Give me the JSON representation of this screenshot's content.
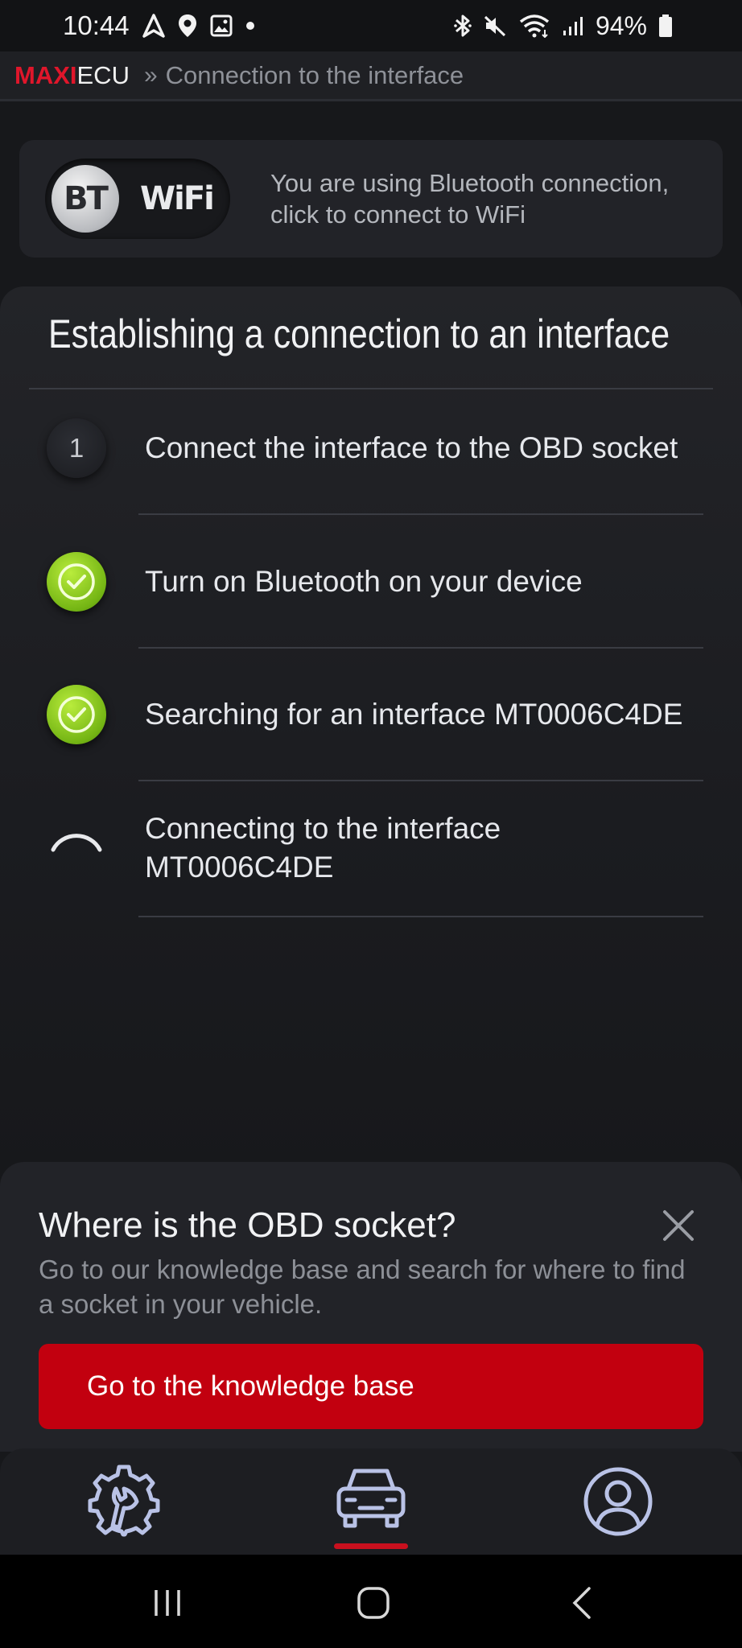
{
  "status_bar": {
    "time": "10:44",
    "battery": "94%",
    "left_icons": [
      "navigation-icon",
      "location-pin-icon",
      "image-icon",
      "dot-icon"
    ],
    "right_icons": [
      "bluetooth-icon",
      "mute-icon",
      "wifi-icon",
      "signal-icon",
      "battery-icon"
    ]
  },
  "header": {
    "logo_maxi": "MAXI",
    "logo_ecu": "ECU",
    "separator": "»",
    "breadcrumb": "Connection to the interface"
  },
  "connection": {
    "toggle_bt": "BT",
    "toggle_wifi": "WiFi",
    "selected": "BT",
    "message": "You are using Bluetooth connection, click to connect to WiFi"
  },
  "steps_panel": {
    "title": "Establishing a connection to an interface",
    "steps": [
      {
        "marker": "1",
        "state": "pending",
        "label": "Connect the interface to the OBD socket"
      },
      {
        "marker": "",
        "state": "done",
        "label": "Turn on Bluetooth on your device"
      },
      {
        "marker": "",
        "state": "done",
        "label": "Searching for an interface MT0006C4DE"
      },
      {
        "marker": "",
        "state": "in-progress",
        "label_line1": "Connecting to the interface",
        "label_line2": "MT0006C4DE"
      }
    ]
  },
  "sheet": {
    "title": "Where is the OBD socket?",
    "description": "Go to our knowledge base and search for where to find a socket in your vehicle.",
    "button": "Go to the knowledge base"
  },
  "bottom_nav": {
    "items": [
      "settings-wrench-icon",
      "car-icon",
      "profile-icon"
    ],
    "active": "car-icon"
  },
  "colors": {
    "brand_red": "#e0162b",
    "button_red": "#c2000f",
    "check_green": "#8ccc1f",
    "background": "#17181b"
  }
}
